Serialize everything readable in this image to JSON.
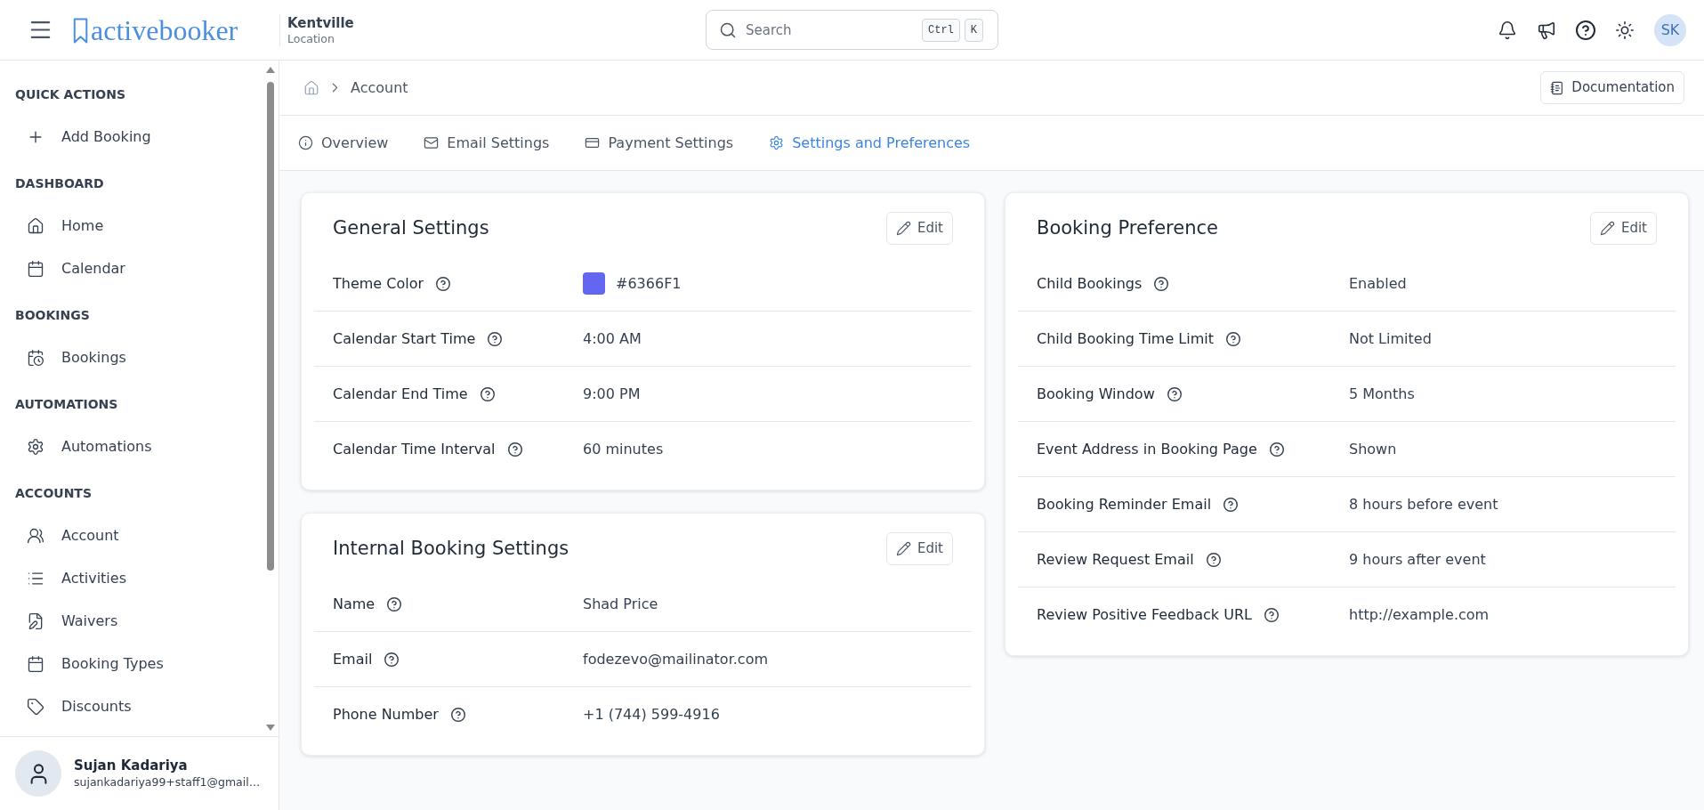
{
  "header": {
    "logo": "activebooker",
    "location": {
      "name": "Kentville",
      "label": "Location"
    },
    "search": {
      "placeholder": "Search",
      "shortcut_keys": [
        "Ctrl",
        "K"
      ]
    },
    "avatar_initials": "SK"
  },
  "sidebar": {
    "sections": [
      {
        "heading": "QUICK ACTIONS",
        "items": [
          "Add Booking"
        ]
      },
      {
        "heading": "DASHBOARD",
        "items": [
          "Home",
          "Calendar"
        ]
      },
      {
        "heading": "BOOKINGS",
        "items": [
          "Bookings"
        ]
      },
      {
        "heading": "AUTOMATIONS",
        "items": [
          "Automations"
        ]
      },
      {
        "heading": "ACCOUNTS",
        "items": [
          "Account",
          "Activities",
          "Waivers",
          "Booking Types",
          "Discounts"
        ]
      }
    ],
    "user": {
      "name": "Sujan Kadariya",
      "email": "sujankadariya99+staff1@gmail…"
    }
  },
  "breadcrumb": {
    "current": "Account"
  },
  "documentation_button": "Documentation",
  "tabs": [
    {
      "label": "Overview",
      "selected": false
    },
    {
      "label": "Email Settings",
      "selected": false
    },
    {
      "label": "Payment Settings",
      "selected": false
    },
    {
      "label": "Settings and Preferences",
      "selected": true
    }
  ],
  "columns": [
    {
      "cards": [
        {
          "title": "General Settings",
          "edit_button": "Edit",
          "rows": [
            {
              "kind": "color",
              "label": "Theme Color",
              "value": "#6366F1",
              "color": "#6366f1"
            },
            {
              "kind": "text",
              "label": "Calendar Start Time",
              "value": "4:00 AM"
            },
            {
              "kind": "text",
              "label": "Calendar End Time",
              "value": "9:00 PM"
            },
            {
              "kind": "text",
              "label": "Calendar Time Interval",
              "value": "60 minutes"
            }
          ]
        },
        {
          "title": "Internal Booking Settings",
          "edit_button": "Edit",
          "rows": [
            {
              "kind": "text",
              "label": "Name",
              "value": "Shad Price"
            },
            {
              "kind": "text",
              "label": "Email",
              "value": "fodezevo@mailinator.com"
            },
            {
              "kind": "text",
              "label": "Phone Number",
              "value": "+1 (744) 599-4916"
            }
          ]
        }
      ]
    },
    {
      "cards": [
        {
          "title": "Booking Preference",
          "edit_button": "Edit",
          "rows": [
            {
              "kind": "text",
              "label": "Child Bookings",
              "value": "Enabled"
            },
            {
              "kind": "text",
              "label": "Child Booking Time Limit",
              "value": "Not Limited"
            },
            {
              "kind": "text",
              "label": "Booking Window",
              "value": "5 Months"
            },
            {
              "kind": "text",
              "label": "Event Address in Booking Page",
              "value": "Shown"
            },
            {
              "kind": "text",
              "label": "Booking Reminder Email",
              "value": "8 hours before event"
            },
            {
              "kind": "text",
              "label": "Review Request Email",
              "value": "9 hours after event"
            },
            {
              "kind": "text",
              "label": "Review Positive Feedback URL",
              "value": "http://example.com"
            }
          ]
        }
      ]
    }
  ]
}
